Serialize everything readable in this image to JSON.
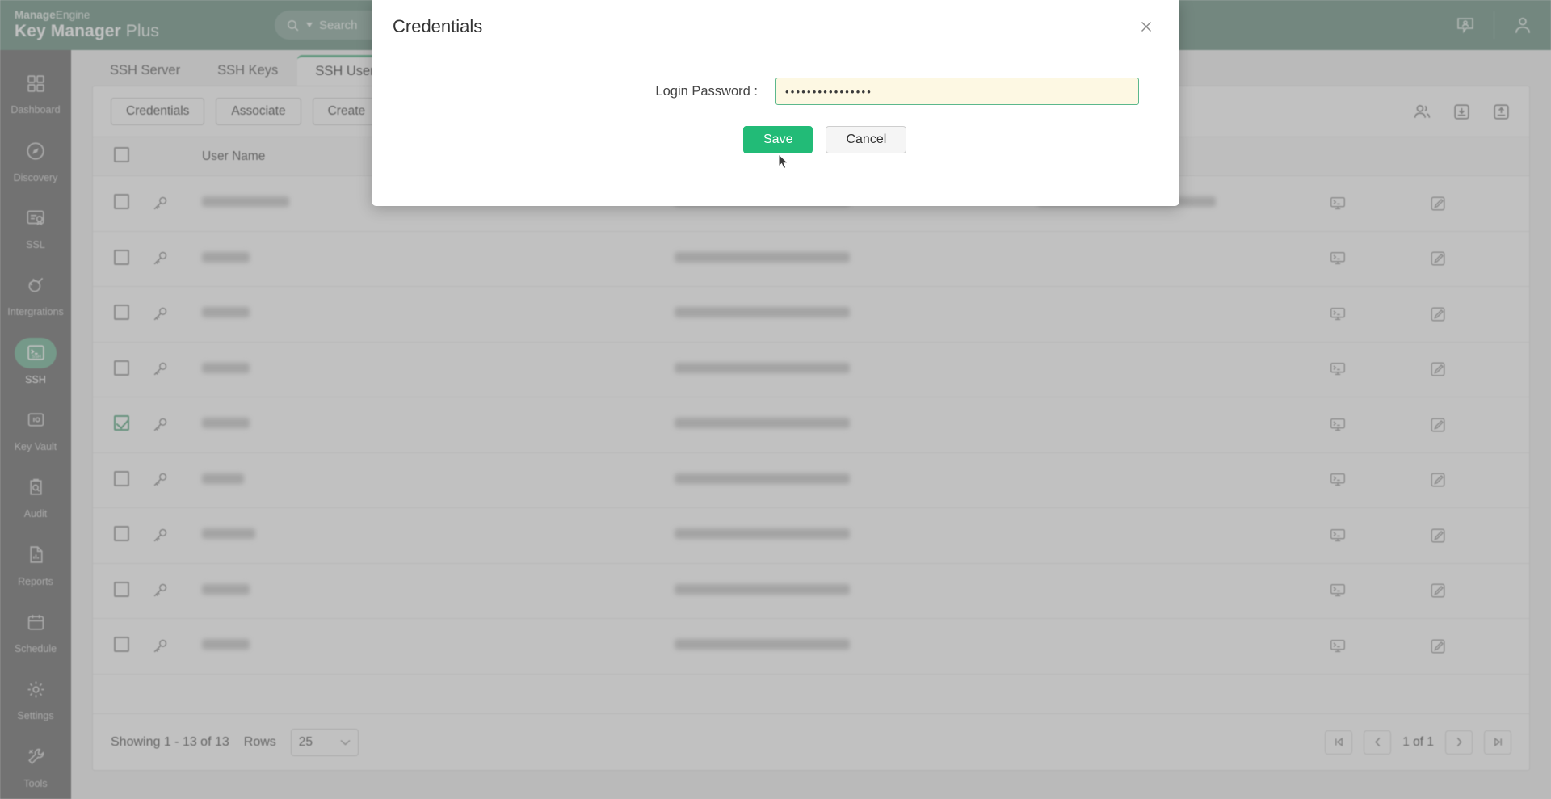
{
  "header": {
    "brand_prefix": "Manage",
    "brand_suffix": "Engine",
    "product_bold": "Key Manager",
    "product_light": " Plus",
    "search_placeholder": "Search",
    "icons": {
      "contact": "contact-support-icon",
      "user": "user-account-icon"
    }
  },
  "sidebar": {
    "items": [
      {
        "label": "Dashboard",
        "icon": "dashboard-icon",
        "active": false
      },
      {
        "label": "Discovery",
        "icon": "discovery-icon",
        "active": false
      },
      {
        "label": "SSL",
        "icon": "ssl-certificate-icon",
        "active": false
      },
      {
        "label": "Intergrations",
        "icon": "integrations-plug-icon",
        "active": false
      },
      {
        "label": "SSH",
        "icon": "ssh-terminal-icon",
        "active": true
      },
      {
        "label": "Key Vault",
        "icon": "key-vault-safe-icon",
        "active": false
      },
      {
        "label": "Audit",
        "icon": "audit-clipboard-icon",
        "active": false
      },
      {
        "label": "Reports",
        "icon": "reports-document-icon",
        "active": false
      },
      {
        "label": "Schedule",
        "icon": "schedule-calendar-icon",
        "active": false
      },
      {
        "label": "Settings",
        "icon": "settings-gear-icon",
        "active": false
      },
      {
        "label": "Tools",
        "icon": "tools-wrench-icon",
        "active": false
      }
    ]
  },
  "main": {
    "tabs": [
      {
        "label": "SSH Server",
        "active": false
      },
      {
        "label": "SSH Keys",
        "active": false
      },
      {
        "label": "SSH Users",
        "active": true
      }
    ],
    "toolbar": {
      "credentials_label": "Credentials",
      "associate_label": "Associate",
      "create_label": "Create",
      "icons": [
        "manage-users-icon",
        "import-icon",
        "export-icon"
      ]
    },
    "table": {
      "columns": [
        "User Name"
      ],
      "rows": [
        {
          "checked": false,
          "user": "              ",
          "host": "                        ",
          "extra": "                         "
        },
        {
          "checked": false,
          "user": "       ",
          "host": "                        ",
          "extra": ""
        },
        {
          "checked": false,
          "user": "       ",
          "host": "                        ",
          "extra": ""
        },
        {
          "checked": false,
          "user": "       ",
          "host": "                        ",
          "extra": ""
        },
        {
          "checked": true,
          "user": "       ",
          "host": "                        ",
          "extra": ""
        },
        {
          "checked": false,
          "user": "      ",
          "host": "                        ",
          "extra": ""
        },
        {
          "checked": false,
          "user": "        ",
          "host": "                        ",
          "extra": ""
        },
        {
          "checked": false,
          "user": "       ",
          "host": "                        ",
          "extra": ""
        },
        {
          "checked": false,
          "user": "       ",
          "host": "                        ",
          "extra": ""
        }
      ]
    },
    "footer": {
      "showing": "Showing 1 - 13 of 13",
      "rows_label": "Rows",
      "rows_value": "25",
      "page_label": "1 of 1"
    }
  },
  "modal": {
    "title": "Credentials",
    "close_icon": "close-icon",
    "password_label": "Login Password :",
    "password_value": "••••••••••••••••",
    "save_label": "Save",
    "cancel_label": "Cancel"
  },
  "colors": {
    "brand_header": "#6f9486",
    "accent_green": "#22bb77",
    "tab_active": "#5cb88c",
    "sidebar": "#6d6d6d",
    "input_bg": "#fdf8e3"
  }
}
